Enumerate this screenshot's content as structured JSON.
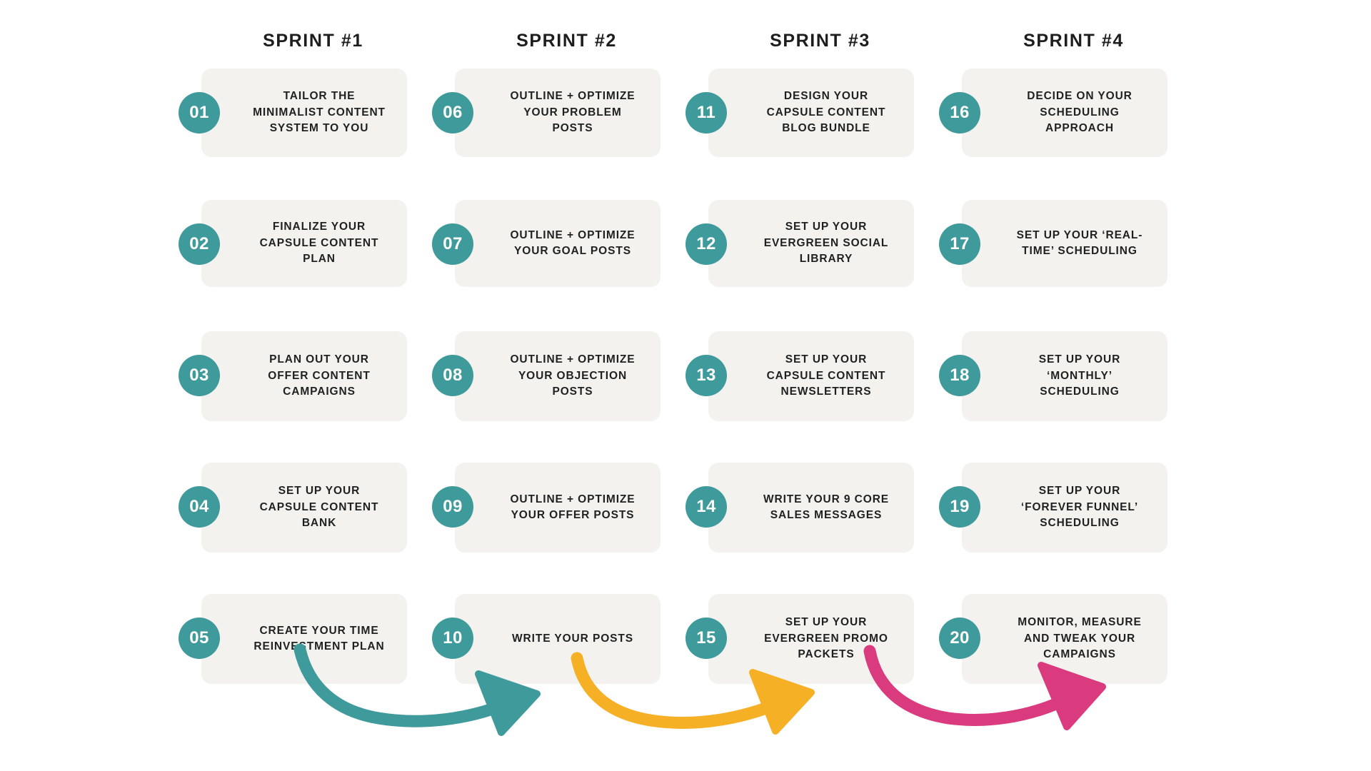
{
  "columns": [
    {
      "header": "SPRINT #1",
      "cards": [
        {
          "number": "01",
          "label": "TAILOR THE MINIMALIST CONTENT SYSTEM TO YOU"
        },
        {
          "number": "02",
          "label": "FINALIZE YOUR CAPSULE CONTENT PLAN"
        },
        {
          "number": "03",
          "label": "PLAN OUT YOUR OFFER CONTENT CAMPAIGNS"
        },
        {
          "number": "04",
          "label": "SET UP YOUR CAPSULE CONTENT BANK"
        },
        {
          "number": "05",
          "label": "CREATE YOUR TIME REINVESTMENT PLAN"
        }
      ]
    },
    {
      "header": "SPRINT #2",
      "cards": [
        {
          "number": "06",
          "label": "OUTLINE + OPTIMIZE YOUR PROBLEM POSTS"
        },
        {
          "number": "07",
          "label": "OUTLINE + OPTIMIZE YOUR GOAL POSTS"
        },
        {
          "number": "08",
          "label": "OUTLINE + OPTIMIZE YOUR OBJECTION POSTS"
        },
        {
          "number": "09",
          "label": "OUTLINE + OPTIMIZE YOUR OFFER POSTS"
        },
        {
          "number": "10",
          "label": "WRITE YOUR POSTS"
        }
      ]
    },
    {
      "header": "SPRINT #3",
      "cards": [
        {
          "number": "11",
          "label": "DESIGN YOUR CAPSULE CONTENT BLOG BUNDLE"
        },
        {
          "number": "12",
          "label": "SET UP YOUR EVERGREEN SOCIAL LIBRARY"
        },
        {
          "number": "13",
          "label": "SET UP YOUR CAPSULE CONTENT NEWSLETTERS"
        },
        {
          "number": "14",
          "label": "WRITE YOUR 9 CORE SALES MESSAGES"
        },
        {
          "number": "15",
          "label": "SET UP YOUR EVERGREEN PROMO PACKETS"
        }
      ]
    },
    {
      "header": "SPRINT #4",
      "cards": [
        {
          "number": "16",
          "label": "DECIDE ON YOUR SCHEDULING APPROACH"
        },
        {
          "number": "17",
          "label": "SET UP YOUR ‘REAL-TIME’ SCHEDULING"
        },
        {
          "number": "18",
          "label": "SET UP YOUR ‘MONTHLY’ SCHEDULING"
        },
        {
          "number": "19",
          "label": "SET UP YOUR ‘FOREVER FUNNEL’ SCHEDULING"
        },
        {
          "number": "20",
          "label": "MONITOR, MEASURE AND TWEAK YOUR CAMPAIGNS"
        }
      ]
    }
  ],
  "arrows": [
    {
      "name": "arrow-sprint1-to-sprint2",
      "color": "#3f9a9b"
    },
    {
      "name": "arrow-sprint2-to-sprint3",
      "color": "#f6b025"
    },
    {
      "name": "arrow-sprint3-to-sprint4",
      "color": "#d93b7e"
    }
  ],
  "theme": {
    "background": "#ffffff",
    "card_background": "#f4f2ef",
    "badge_color": "#3f9a9b",
    "text_color": "#1f2120",
    "header_color": "#1d1d1d"
  }
}
